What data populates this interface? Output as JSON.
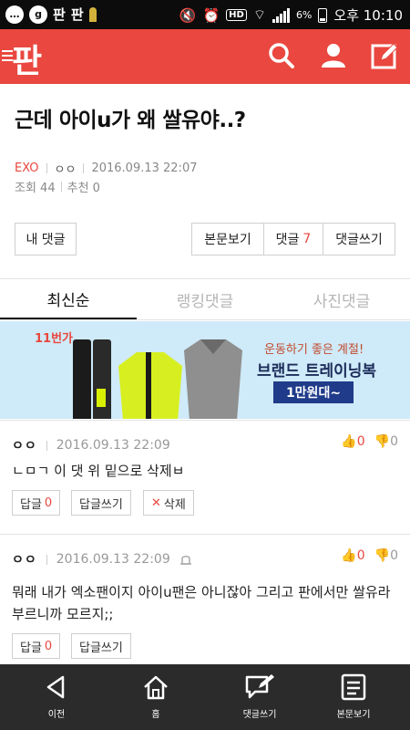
{
  "status_bar": {
    "chip1": "…",
    "chip2": "g",
    "pan1": "판",
    "pan2": "판",
    "battery": "6%",
    "time": "오후 10:10",
    "hd": "HD"
  },
  "header": {
    "logo": "판"
  },
  "post": {
    "title": "근데 아이u가 왜 쌀유야..?",
    "category": "EXO",
    "author": "ㅇㅇ",
    "date": "2016.09.13 22:07",
    "views_label": "조회 44",
    "recommend_label": "추천 0"
  },
  "actions": {
    "my_comments": "내 댓글",
    "view_post": "본문보기",
    "comments_label": "댓글",
    "comments_count": "7",
    "write_comment": "댓글쓰기"
  },
  "tabs": [
    "최신순",
    "랭킹댓글",
    "사진댓글"
  ],
  "ad": {
    "tag": "11번가",
    "line1": "운동하기 좋은 계절!",
    "line2": "브랜드 트레이닝복",
    "price": "1만원대~"
  },
  "comments": [
    {
      "author": "ㅇㅇ",
      "date": "2016.09.13 22:09",
      "up": "0",
      "down": "0",
      "text": "ㄴㅁㄱ 이 댓 위 밑으로 삭제ㅂ",
      "reply_label": "답글",
      "reply_count": "0",
      "write_reply": "답글쓰기",
      "delete": "삭제"
    },
    {
      "author": "ㅇㅇ",
      "date": "2016.09.13 22:09",
      "up": "0",
      "down": "0",
      "text": "뭐래 내가 엑소팬이지 아이u팬은 아니잖아 그리고 판에서만 쌀유라 부르니까 모르지;;",
      "reply_label": "답글",
      "reply_count": "0",
      "write_reply": "답글쓰기"
    }
  ],
  "bottom_nav": [
    "이전",
    "홈",
    "댓글쓰기",
    "본문보기"
  ],
  "colors": {
    "brand": "#e9473f",
    "navbar": "#2b2b2b",
    "status_bar": "#0c0c0c"
  }
}
